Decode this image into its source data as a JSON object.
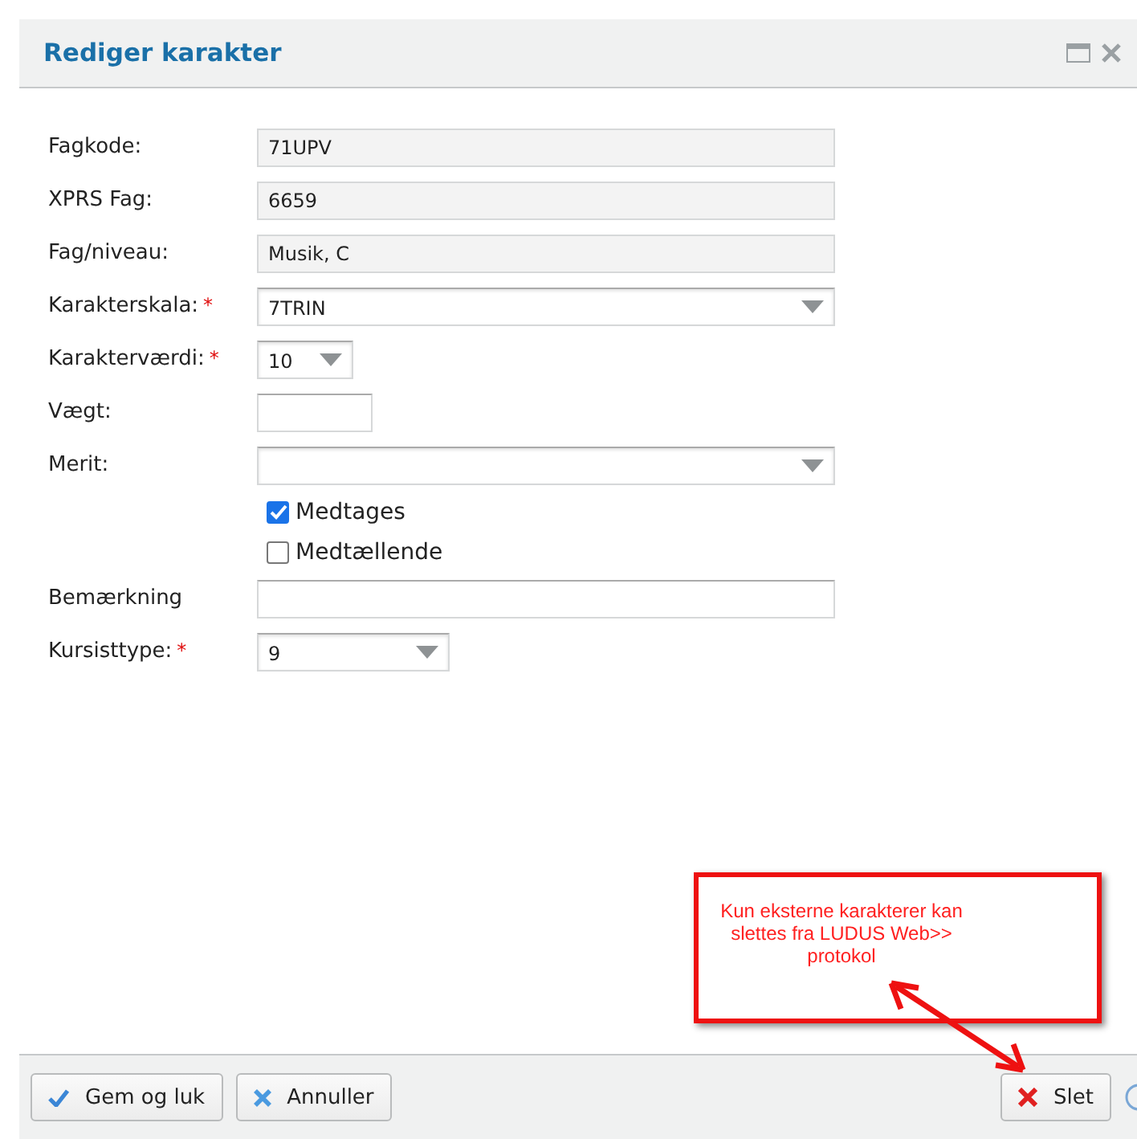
{
  "window": {
    "title": "Rediger karakter"
  },
  "fields": [
    {
      "kind": "readonly",
      "label": "Fagkode:",
      "value": "71UPV"
    },
    {
      "kind": "readonly",
      "label": "XPRS Fag:",
      "value": "6659"
    },
    {
      "kind": "readonly",
      "label": "Fag/niveau:",
      "value": "Musik, C"
    },
    {
      "kind": "select",
      "label": "Karakterskala:",
      "required_mark": "*",
      "value": "7TRIN"
    },
    {
      "kind": "select",
      "label": "Karakterværdi:",
      "required_mark": "*",
      "value": "10"
    },
    {
      "kind": "text",
      "label": "Vægt:"
    },
    {
      "kind": "select",
      "label": "Merit:"
    },
    {
      "kind": "checkbox",
      "label": "Medtages",
      "checked": true
    },
    {
      "kind": "checkbox",
      "label": "Medtællende",
      "checked": false
    },
    {
      "kind": "text",
      "label": "Bemærkning"
    },
    {
      "kind": "select",
      "label": "Kursisttype:",
      "required_mark": "*",
      "value": "9"
    }
  ],
  "callout": {
    "text": "Kun eksterne karakterer kan slettes fra LUDUS Web>> protokol"
  },
  "buttons": [
    {
      "label": "Gem og luk",
      "kind": "save"
    },
    {
      "label": "Annuller",
      "kind": "cancel"
    }
  ],
  "delete_button": {
    "label": "Slet"
  }
}
